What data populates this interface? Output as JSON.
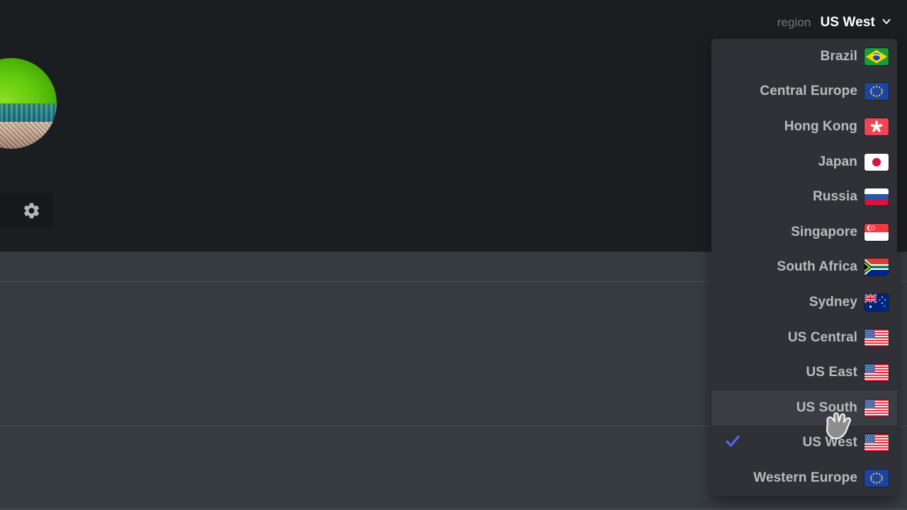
{
  "header": {
    "region_label": "region",
    "region_value": "US West",
    "chevron_icon": "chevron-down-icon"
  },
  "toolbar": {
    "settings_icon": "gear-icon",
    "avatar_icon": "avatar"
  },
  "dropdown": {
    "selected": "US West",
    "hovered": "US South",
    "check_icon": "check-icon",
    "check_color": "#5865f2",
    "background_color": "#2f3136",
    "hover_color": "#3a3d43",
    "label_color": "#b9bbbe",
    "items": [
      {
        "label": "Brazil",
        "flag": "flag-br",
        "selected": false,
        "hovered": false
      },
      {
        "label": "Central Europe",
        "flag": "flag-eu",
        "selected": false,
        "hovered": false
      },
      {
        "label": "Hong Kong",
        "flag": "flag-hk",
        "selected": false,
        "hovered": false
      },
      {
        "label": "Japan",
        "flag": "flag-jp",
        "selected": false,
        "hovered": false
      },
      {
        "label": "Russia",
        "flag": "flag-ru",
        "selected": false,
        "hovered": false
      },
      {
        "label": "Singapore",
        "flag": "flag-sg",
        "selected": false,
        "hovered": false
      },
      {
        "label": "South Africa",
        "flag": "flag-za",
        "selected": false,
        "hovered": false
      },
      {
        "label": "Sydney",
        "flag": "flag-au",
        "selected": false,
        "hovered": false
      },
      {
        "label": "US Central",
        "flag": "flag-us",
        "selected": false,
        "hovered": false
      },
      {
        "label": "US East",
        "flag": "flag-us",
        "selected": false,
        "hovered": false
      },
      {
        "label": "US South",
        "flag": "flag-us",
        "selected": false,
        "hovered": true
      },
      {
        "label": "US West",
        "flag": "flag-us",
        "selected": true,
        "hovered": false
      },
      {
        "label": "Western Europe",
        "flag": "flag-eu",
        "selected": false,
        "hovered": false
      }
    ]
  },
  "cursor": {
    "icon": "grabbing-hand-cursor"
  },
  "colors": {
    "app_background": "#1b1e21",
    "lower_pane": "#363b40",
    "divider": "#4a5055",
    "chip_background": "#16181b",
    "muted_text": "#72767d",
    "primary_text": "#ffffff"
  }
}
